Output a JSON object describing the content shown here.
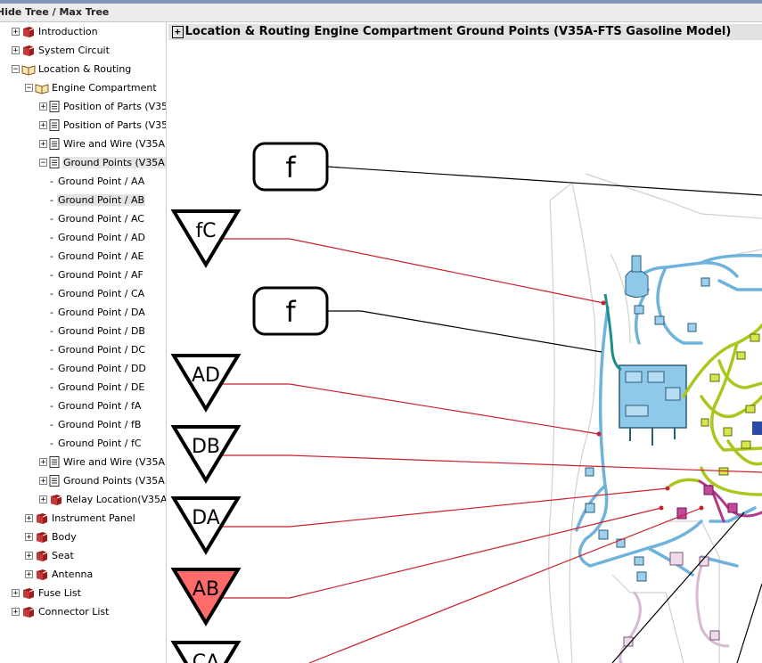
{
  "window": {
    "title": "Hide Tree / Max Tree"
  },
  "tree": {
    "introduction": "Introduction",
    "system_circuit": "System Circuit",
    "location_routing": "Location & Routing",
    "engine_compartment": "Engine Compartment",
    "position_parts_1": "Position of Parts (V35",
    "position_parts_2": "Position of Parts (V35",
    "wire_and_wire_1": "Wire and Wire (V35A",
    "ground_points_1": "Ground Points (V35A",
    "ground_points": [
      "Ground Point / AA",
      "Ground Point / AB",
      "Ground Point / AC",
      "Ground Point / AD",
      "Ground Point / AE",
      "Ground Point / AF",
      "Ground Point / CA",
      "Ground Point / DA",
      "Ground Point / DB",
      "Ground Point / DC",
      "Ground Point / DD",
      "Ground Point / DE",
      "Ground Point / fA",
      "Ground Point / fB",
      "Ground Point / fC"
    ],
    "wire_and_wire_2": "Wire and Wire (V35A",
    "ground_points_2": "Ground Points (V35A",
    "relay_location": "Relay Location(V35A",
    "instrument_panel": "Instrument Panel",
    "body": "Body",
    "seat": "Seat",
    "antenna": "Antenna",
    "fuse_list": "Fuse List",
    "connector_list": "Connector List"
  },
  "main": {
    "expand_label": "+",
    "title": "Location & Routing  Engine Compartment  Ground Points (V35A-FTS Gasoline Model)"
  },
  "diagram": {
    "labels": {
      "f_top": "f",
      "fc": "fC",
      "f_mid": "f",
      "ad": "AD",
      "db": "DB",
      "da": "DA",
      "ab": "AB",
      "ca": "CA"
    },
    "highlight_color": "#ff6b6b",
    "leader_red": "#cc1f2e"
  }
}
